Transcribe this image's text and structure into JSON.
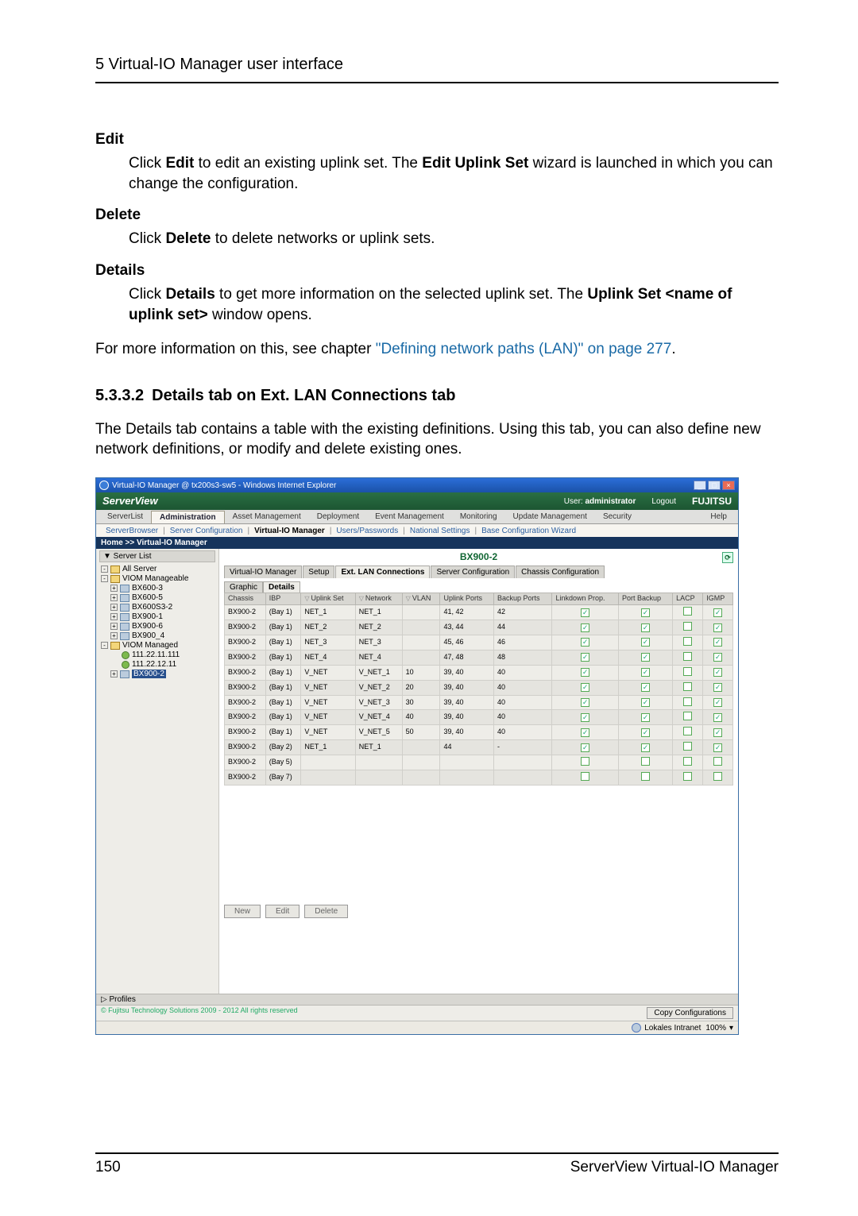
{
  "header": "5 Virtual-IO Manager user interface",
  "edit": {
    "term": "Edit",
    "text_pre": "Click ",
    "b1": "Edit",
    "text_mid": " to edit an existing uplink set. The ",
    "b2": "Edit Uplink Set",
    "text_post": " wizard is launched in which you can change the configuration."
  },
  "delete": {
    "term": "Delete",
    "text_pre": "Click ",
    "b1": "Delete",
    "text_post": " to delete networks or uplink sets."
  },
  "details": {
    "term": "Details",
    "text_pre": "Click ",
    "b1": "Details",
    "text_mid": " to get more information on the selected uplink set. The ",
    "b2": "Uplink Set <name of uplink set>",
    "text_post": " window opens."
  },
  "more_pre": "For more information on this, see chapter ",
  "more_link": "\"Defining network paths (LAN)\" on page 277",
  "more_post": ".",
  "section": {
    "num": "5.3.3.2",
    "title": "Details tab on Ext. LAN Connections tab"
  },
  "section_body_pre": "The ",
  "section_body_b": "Details",
  "section_body_post": " tab contains a table with the existing definitions. Using this tab, you can also define new network definitions, or modify and delete existing ones.",
  "win_title": "Virtual-IO Manager @ tx200s3-sw5 - Windows Internet Explorer",
  "brand": "ServerView",
  "user_label": "User:",
  "user_value": "administrator",
  "logout": "Logout",
  "fujitsu": "FUJITSU",
  "help": "Help",
  "nav1": [
    "ServerList",
    "Administration",
    "Asset Management",
    "Deployment",
    "Event Management",
    "Monitoring",
    "Update Management",
    "Security"
  ],
  "nav2": [
    "ServerBrowser",
    "Server Configuration",
    "Virtual-IO Manager",
    "Users/Passwords",
    "National Settings",
    "Base Configuration Wizard"
  ],
  "crumbs": "Home >> Virtual-IO Manager",
  "side_head": "▼ Server List",
  "tree": {
    "all": "All Server",
    "manageable": "VIOM Manageable",
    "items1": [
      "BX600-3",
      "BX600-5",
      "BX600S3-2",
      "BX900-1",
      "BX900-6",
      "BX900_4"
    ],
    "managed": "VIOM Managed",
    "ips": [
      "111.22.11.111",
      "111.22.12.11"
    ],
    "selected": "BX900-2"
  },
  "content_title": "BX900-2",
  "tabs": [
    "Virtual-IO Manager",
    "Setup",
    "Ext. LAN Connections",
    "Server Configuration",
    "Chassis Configuration"
  ],
  "subtabs": [
    "Graphic",
    "Details"
  ],
  "grid": {
    "headers": [
      "Chassis",
      "IBP",
      "Uplink Set",
      "Network",
      "VLAN",
      "Uplink Ports",
      "Backup Ports",
      "Linkdown Prop.",
      "Port Backup",
      "LACP",
      "IGMP"
    ],
    "rows": [
      {
        "alt": false,
        "c": [
          "BX900-2",
          "(Bay 1)",
          "NET_1",
          "NET_1",
          "",
          "41, 42",
          "42",
          true,
          true,
          false,
          true
        ]
      },
      {
        "alt": true,
        "c": [
          "BX900-2",
          "(Bay 1)",
          "NET_2",
          "NET_2",
          "",
          "43, 44",
          "44",
          true,
          true,
          false,
          true
        ]
      },
      {
        "alt": false,
        "c": [
          "BX900-2",
          "(Bay 1)",
          "NET_3",
          "NET_3",
          "",
          "45, 46",
          "46",
          true,
          true,
          false,
          true
        ]
      },
      {
        "alt": true,
        "c": [
          "BX900-2",
          "(Bay 1)",
          "NET_4",
          "NET_4",
          "",
          "47, 48",
          "48",
          true,
          true,
          false,
          true
        ]
      },
      {
        "alt": false,
        "c": [
          "BX900-2",
          "(Bay 1)",
          "V_NET",
          "V_NET_1",
          "10",
          "39, 40",
          "40",
          true,
          true,
          false,
          true
        ]
      },
      {
        "alt": true,
        "c": [
          "BX900-2",
          "(Bay 1)",
          "V_NET",
          "V_NET_2",
          "20",
          "39, 40",
          "40",
          true,
          true,
          false,
          true
        ]
      },
      {
        "alt": false,
        "c": [
          "BX900-2",
          "(Bay 1)",
          "V_NET",
          "V_NET_3",
          "30",
          "39, 40",
          "40",
          true,
          true,
          false,
          true
        ]
      },
      {
        "alt": true,
        "c": [
          "BX900-2",
          "(Bay 1)",
          "V_NET",
          "V_NET_4",
          "40",
          "39, 40",
          "40",
          true,
          true,
          false,
          true
        ]
      },
      {
        "alt": false,
        "c": [
          "BX900-2",
          "(Bay 1)",
          "V_NET",
          "V_NET_5",
          "50",
          "39, 40",
          "40",
          true,
          true,
          false,
          true
        ]
      },
      {
        "alt": true,
        "c": [
          "BX900-2",
          "(Bay 2)",
          "NET_1",
          "NET_1",
          "",
          "44",
          "-",
          true,
          true,
          false,
          true
        ]
      },
      {
        "alt": false,
        "c": [
          "BX900-2",
          "(Bay 5)",
          "",
          "",
          "",
          "",
          "",
          false,
          false,
          false,
          false
        ]
      },
      {
        "alt": true,
        "c": [
          "BX900-2",
          "(Bay 7)",
          "",
          "",
          "",
          "",
          "",
          false,
          false,
          false,
          false
        ]
      }
    ]
  },
  "buttons": {
    "new": "New",
    "edit": "Edit",
    "del": "Delete"
  },
  "profiles": "▷ Profiles",
  "copy_cfg": "Copy Configurations",
  "copyright": "© Fujitsu Technology Solutions 2009 - 2012 All rights reserved",
  "ie_status": {
    "zone": "Lokales Intranet",
    "zoom": "100%"
  },
  "footer": {
    "page": "150",
    "product": "ServerView Virtual-IO Manager"
  }
}
